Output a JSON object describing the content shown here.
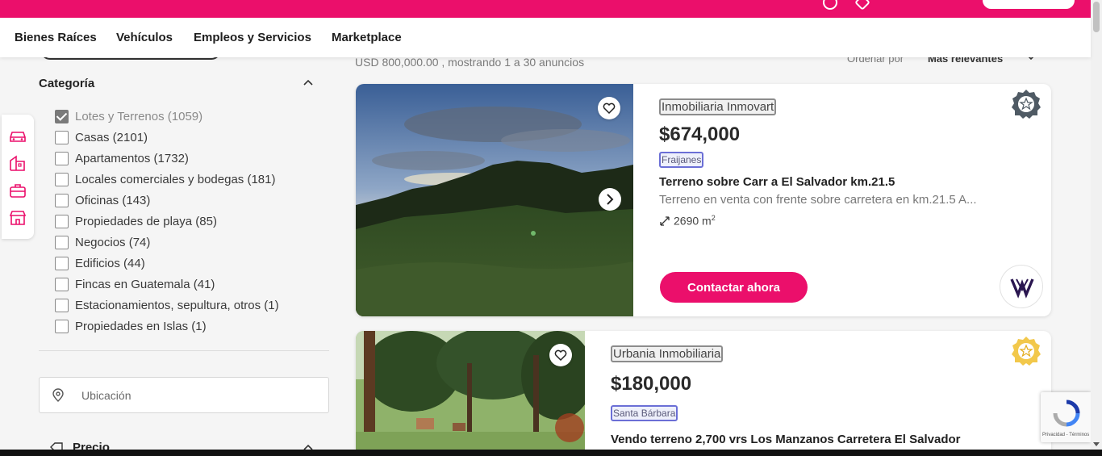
{
  "nav": {
    "items": [
      "Bienes Raíces",
      "Vehículos",
      "Empleos y Servicios",
      "Marketplace"
    ]
  },
  "filters": {
    "category_title": "Categoría",
    "categories": [
      {
        "label": "Lotes y Terrenos (1059)",
        "checked": true
      },
      {
        "label": "Casas (2101)",
        "checked": false
      },
      {
        "label": "Apartamentos (1732)",
        "checked": false
      },
      {
        "label": "Locales comerciales y bodegas (181)",
        "checked": false
      },
      {
        "label": "Oficinas (143)",
        "checked": false
      },
      {
        "label": "Propiedades de playa (85)",
        "checked": false
      },
      {
        "label": "Negocios (74)",
        "checked": false
      },
      {
        "label": "Edificios (44)",
        "checked": false
      },
      {
        "label": "Fincas en Guatemala (41)",
        "checked": false
      },
      {
        "label": "Estacionamientos, sepultura, otros (1)",
        "checked": false
      },
      {
        "label": "Propiedades en Islas (1)",
        "checked": false
      }
    ],
    "location_placeholder": "Ubicación",
    "price_title": "Precio"
  },
  "results": {
    "summary": "USD 800,000.00 , mostrando 1 a 30 anuncios",
    "sort_label": "Ordenar por",
    "sort_value": "Más relevantes"
  },
  "listings": [
    {
      "agency": "Inmobiliaria Inmovart",
      "price": "$674,000",
      "location": "Fraijanes",
      "title": "Terreno sobre Carr a El Salvador km.21.5",
      "description": "Terreno en venta con frente sobre carretera en km.21.5 A...",
      "area": "2690 m",
      "area_unit_sup": "2",
      "contact_label": "Contactar ahora",
      "badge_color": "#4f5a64"
    },
    {
      "agency": "Urbania Inmobiliaria",
      "price": "$180,000",
      "location": "Santa Bárbara",
      "title": "Vendo terreno 2,700 vrs Los Manzanos Carretera El Salvador",
      "badge_color": "#f2c84b"
    }
  ],
  "recaptcha": {
    "footer": "Privacidad - Términos"
  },
  "colors": {
    "brand": "#eb0f6b",
    "location_tag_border": "#6b6fd6"
  }
}
